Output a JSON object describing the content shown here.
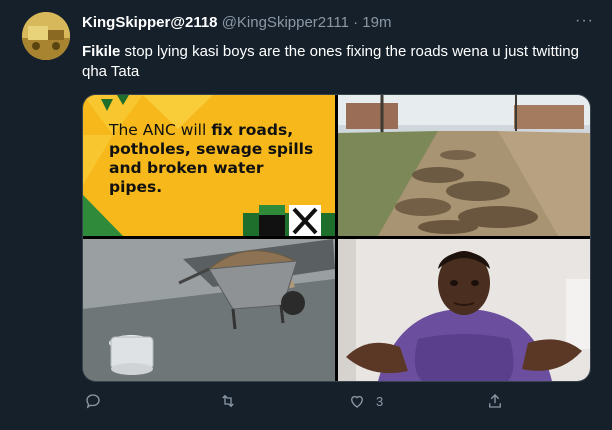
{
  "tweet": {
    "display_name": "KingSkipper@2118",
    "handle": "@KingSkipper2111",
    "separator": "·",
    "time": "19m",
    "more": "···",
    "text_bold": "Fikile",
    "text_rest": " stop lying kasi boys are the ones fixing the roads wena u just twitting qha Tata"
  },
  "media": {
    "image1": {
      "line1_pre": "The ANC will ",
      "line1_bold": "fix roads,",
      "line2_bold": "potholes, sewage spills",
      "line3_bold": "and broken water pipes."
    }
  },
  "actions": {
    "reply_icon": "reply-icon",
    "retweet_icon": "retweet-icon",
    "like_icon": "heart-icon",
    "like_count": "3",
    "share_icon": "share-icon"
  },
  "colors": {
    "background": "#15202b",
    "muted": "#8b98a5",
    "text": "#ffffff"
  }
}
